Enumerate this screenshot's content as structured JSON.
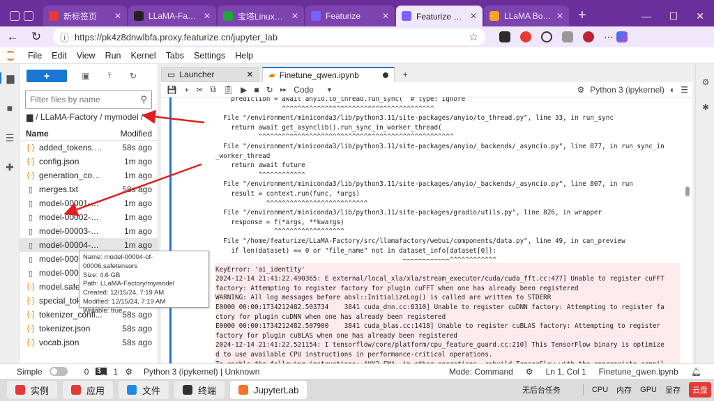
{
  "browser": {
    "tabs": [
      {
        "title": "新标签页",
        "color": "#e53935",
        "active": false,
        "width": 120
      },
      {
        "title": "LLaMA-Factory/data/dat",
        "color": "#222222",
        "active": false,
        "width": 126
      },
      {
        "title": "宝塔Linux面板",
        "color": "#20a53a",
        "active": false,
        "width": 124
      },
      {
        "title": "Featurize",
        "color": "#7b61ff",
        "active": false,
        "width": 128
      },
      {
        "title": "Featurize 工作区",
        "color": "#7b61ff",
        "active": true,
        "width": 124
      },
      {
        "title": "LLaMA Board (featu",
        "color": "#f5a623",
        "active": false,
        "width": 122
      }
    ],
    "url": "https://pk4z8dnwlbfa.proxy.featurize.cn/jupyter_lab"
  },
  "menu": [
    "File",
    "Edit",
    "View",
    "Run",
    "Kernel",
    "Tabs",
    "Settings",
    "Help"
  ],
  "filebrowser": {
    "new_label": "+",
    "filter_placeholder": "Filter files by name",
    "breadcrumb": "/ LLaMA-Factory / mymodel /",
    "col_name": "Name",
    "col_modified": "Modified",
    "files": [
      {
        "name": "added_tokens.js...",
        "mod": "58s ago",
        "icon": "json"
      },
      {
        "name": "config.json",
        "mod": "1m ago",
        "icon": "json"
      },
      {
        "name": "generation_conf...",
        "mod": "1m ago",
        "icon": "json"
      },
      {
        "name": "merges.txt",
        "mod": "58s ago",
        "icon": "doc"
      },
      {
        "name": "model-00001-of...",
        "mod": "1m ago",
        "icon": "doc"
      },
      {
        "name": "model-00002-of...",
        "mod": "1m ago",
        "icon": "doc"
      },
      {
        "name": "model-00003-of...",
        "mod": "1m ago",
        "icon": "doc"
      },
      {
        "name": "model-00004-of...",
        "mod": "1m ago",
        "icon": "doc"
      },
      {
        "name": "model-0000",
        "mod": "1m ago",
        "icon": "doc"
      },
      {
        "name": "model-0000",
        "mod": "1m ago",
        "icon": "doc"
      },
      {
        "name": "model.safet",
        "mod": "1m ago",
        "icon": "json"
      },
      {
        "name": "special_toke",
        "mod": "58s ago",
        "icon": "json"
      },
      {
        "name": "tokenizer_confi...",
        "mod": "58s ago",
        "icon": "json"
      },
      {
        "name": "tokenizer.json",
        "mod": "58s ago",
        "icon": "json"
      },
      {
        "name": "vocab.json",
        "mod": "58s ago",
        "icon": "json"
      }
    ],
    "tooltip": [
      "Name: model-00004-of-00006.safetensors",
      "Size: 4.6 GB",
      "Path: LLaMA-Factory/mymodel",
      "Created: 12/15/24, 7:19 AM",
      "Modified: 12/15/24, 7:19 AM",
      "Writable: true"
    ]
  },
  "doc_tabs": {
    "launcher": "Launcher",
    "notebook": "Finetune_qwen.ipynb"
  },
  "toolbar": {
    "cell_type": "Code",
    "kernel": "Python 3 (ipykernel)"
  },
  "output_lines": [
    "    prediction = await anyio.to_thread.run_sync(  # type: ignore",
    "                 ^^^^^^^^^^^^^^^^^^^^^^^^^^^^^^^^^^^^^^^",
    "  File \"/environment/miniconda3/lib/python3.11/site-packages/anyio/to_thread.py\", line 33, in run_sync",
    "    return await get_asynclib().run_sync_in_worker_thread(",
    "           ^^^^^^^^^^^^^^^^^^^^^^^^^^^^^^^^^^^^^^^^^^^^^^^^^^",
    "  File \"/environment/miniconda3/lib/python3.11/site-packages/anyio/_backends/_asyncio.py\", line 877, in run_sync_in",
    "_worker_thread",
    "    return await future",
    "           ^^^^^^^^^^^^",
    "  File \"/environment/miniconda3/lib/python3.11/site-packages/anyio/_backends/_asyncio.py\", line 807, in run",
    "    result = context.run(func, *args)",
    "             ^^^^^^^^^^^^^^^^^^^^^^^^^^",
    "  File \"/environment/miniconda3/lib/python3.11/site-packages/gradio/utils.py\", line 826, in wrapper",
    "    response = f(*args, **kwargs)",
    "               ^^^^^^^^^^^^^^^^^^",
    "  File \"/home/featurize/LLaMA-Factory/src/llamafactory/webui/components/data.py\", line 49, in can_preview",
    "    if len(dataset) == 0 or \"file_name\" not in dataset_info[dataset[0]]:",
    "                                                ~~~~~~~~~~~~^^^^^^^^^^^^",
    "KeyError: 'ai_identity'",
    "2024-12-14 21:41:22.490365: E external/local_xla/xla/stream_executor/cuda/cuda_fft.cc:477] Unable to register cuFFT",
    "factory: Attempting to register factory for plugin cuFFT when one has already been registered",
    "WARNING: All log messages before absl::InitializeLog() is called are written to STDERR",
    "E0000 00:00:1734212482.503734    3841 cuda_dnn.cc:8310] Unable to register cuDNN factory: Attempting to register fa",
    "ctory for plugin cuDNN when one has already been registered",
    "E0000 00:00:1734212482.507900    3841 cuda_blas.cc:1418] Unable to register cuBLAS factory: Attempting to register",
    "factory for plugin cuBLAS when one has already been registered",
    "2024-12-14 21:41:22.521154: I tensorflow/core/platform/cpu_feature_guard.cc:210] This TensorFlow binary is optimize",
    "d to use available CPU instructions in performance-critical operations.",
    "To enable the following instructions: AVX2 FMA, in other operations, rebuild TensorFlow with the appropriate compil"
  ],
  "status": {
    "mode_label": "Simple",
    "count_a": "0",
    "count_b": "1",
    "kernel": "Python 3 (ipykernel) | Unknown",
    "mode": "Mode: Command",
    "pos": "Ln 1, Col 1",
    "file": "Finetune_qwen.ipynb"
  },
  "taskbar": {
    "items": [
      {
        "label": "实例",
        "color": "#e53935"
      },
      {
        "label": "应用",
        "color": "#e53935"
      },
      {
        "label": "文件",
        "color": "#1e88e5"
      },
      {
        "label": "终端",
        "color": "#333333"
      },
      {
        "label": "JupyterLab",
        "color": "#f37626"
      }
    ],
    "tray": [
      "无后台任务",
      "CPU",
      "内存",
      "GPU",
      "显存"
    ],
    "cloud": "云盘"
  }
}
